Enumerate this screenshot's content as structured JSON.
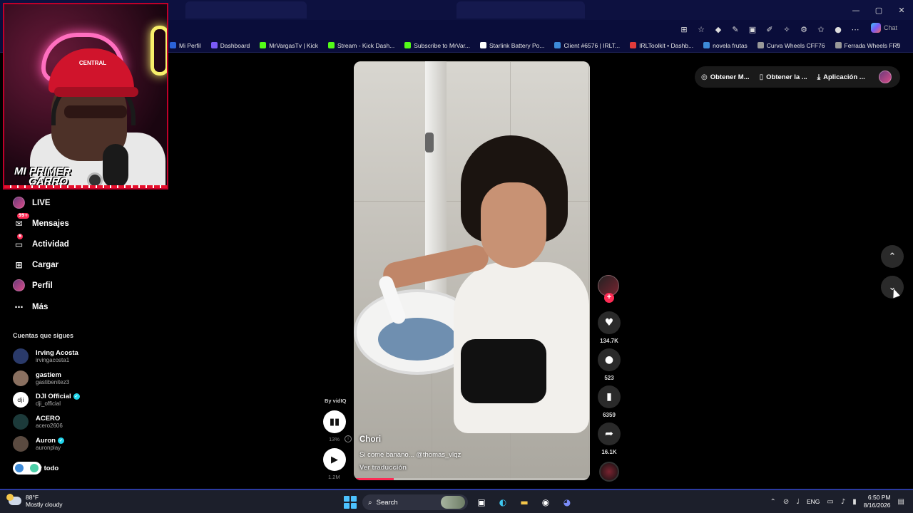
{
  "browser": {
    "chat_label": "Chat",
    "window_controls": {
      "minimize": "—",
      "maximize": "▢",
      "close": "✕"
    }
  },
  "bookmarks": [
    {
      "label": "Mi Perfil",
      "color": "#2b63d9"
    },
    {
      "label": "Dashboard",
      "color": "#7a5af8"
    },
    {
      "label": "MrVargasTv | Kick",
      "color": "#53fc18"
    },
    {
      "label": "Stream - Kick Dash...",
      "color": "#53fc18"
    },
    {
      "label": "Subscribe to MrVar...",
      "color": "#53fc18"
    },
    {
      "label": "Starlink Battery Po...",
      "color": "#ffffff"
    },
    {
      "label": "Client #6576 | IRLT...",
      "color": "#3d8bd8"
    },
    {
      "label": "IRLToolkit • Dashb...",
      "color": "#e23b3b"
    },
    {
      "label": "novela frutas",
      "color": "#3d8bd8"
    },
    {
      "label": "Curva Wheels CFF76",
      "color": "#999999"
    },
    {
      "label": "Ferrada Wheels FR9",
      "color": "#999999"
    }
  ],
  "webcam": {
    "title_line1": "MI PRIMER",
    "title_line2": "CARRO",
    "cap_text": "CENTRAL"
  },
  "sidebar": {
    "items": [
      {
        "label": "LIVE",
        "icon": "live-avatar-icon"
      },
      {
        "label": "Mensajes",
        "icon": "messages-icon",
        "badge": "99+"
      },
      {
        "label": "Actividad",
        "icon": "activity-icon",
        "badge": "6"
      },
      {
        "label": "Cargar",
        "icon": "upload-icon"
      },
      {
        "label": "Perfil",
        "icon": "profile-avatar-icon"
      },
      {
        "label": "Más",
        "icon": "more-icon"
      }
    ],
    "following_title": "Cuentas que sigues",
    "following": [
      {
        "name": "Irving Acosta",
        "handle": "irvingacosta1",
        "verified": false
      },
      {
        "name": "gastiem",
        "handle": "gastibenitez3",
        "verified": false
      },
      {
        "name": "DJI Official",
        "handle": "dji_official",
        "verified": true
      },
      {
        "name": "ACERO",
        "handle": "acero2606",
        "verified": false
      },
      {
        "name": "Auron",
        "handle": "auronplay",
        "verified": true
      }
    ],
    "see_all": "er todo"
  },
  "video": {
    "author": "Chori",
    "caption": "Si come banano... @thomas_vlqz",
    "translate": "Ver traducción",
    "progress": 0.17
  },
  "actions": {
    "likes": "134.7K",
    "comments": "523",
    "saves": "6359",
    "shares": "16.1K"
  },
  "vidiq": {
    "by": "By vidIQ",
    "percent": "13%",
    "views": "1.2M"
  },
  "topbar": {
    "item1": "Obtener M...",
    "item2": "Obtener la ...",
    "item3": "Aplicación ..."
  },
  "taskbar": {
    "temp": "88°F",
    "weather": "Mostly cloudy",
    "search": "Search",
    "lang": "ENG",
    "time": "6:50 PM",
    "date": "8/16/2026"
  }
}
